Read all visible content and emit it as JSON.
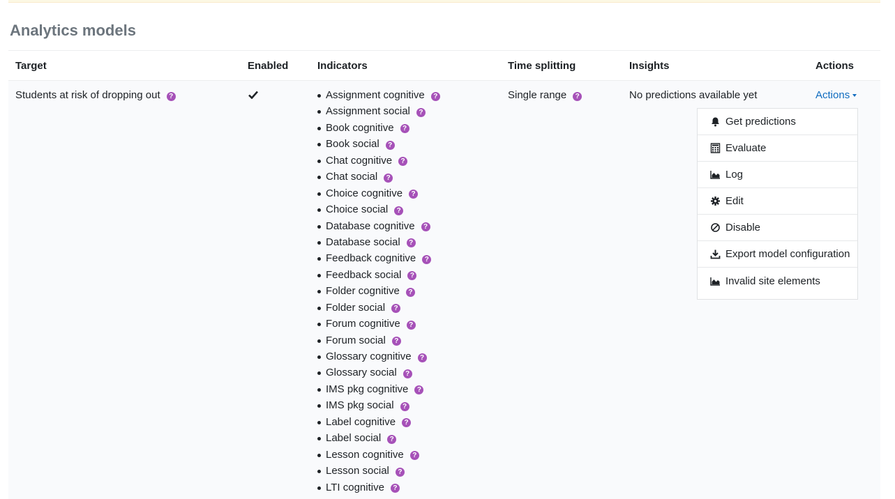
{
  "page": {
    "title": "Analytics models"
  },
  "table": {
    "headers": [
      "Target",
      "Enabled",
      "Indicators",
      "Time splitting",
      "Insights",
      "Actions"
    ],
    "row": {
      "target": "Students at risk of dropping out",
      "enabled": true,
      "time_splitting": "Single range",
      "insights": "No predictions available yet",
      "actions_label": "Actions",
      "indicators": [
        "Assignment cognitive",
        "Assignment social",
        "Book cognitive",
        "Book social",
        "Chat cognitive",
        "Chat social",
        "Choice cognitive",
        "Choice social",
        "Database cognitive",
        "Database social",
        "Feedback cognitive",
        "Feedback social",
        "Folder cognitive",
        "Folder social",
        "Forum cognitive",
        "Forum social",
        "Glossary cognitive",
        "Glossary social",
        "IMS pkg cognitive",
        "IMS pkg social",
        "Label cognitive",
        "Label social",
        "Lesson cognitive",
        "Lesson social",
        "LTI cognitive"
      ]
    }
  },
  "actions_menu": [
    {
      "label": "Get predictions",
      "icon": "bell-icon"
    },
    {
      "label": "Evaluate",
      "icon": "calculator-icon"
    },
    {
      "label": "Log",
      "icon": "area-chart-icon"
    },
    {
      "label": "Edit",
      "icon": "gear-icon"
    },
    {
      "label": "Disable",
      "icon": "ban-icon"
    },
    {
      "label": "Export model configuration",
      "icon": "download-icon"
    },
    {
      "label": "Invalid site elements",
      "icon": "area-chart-icon"
    }
  ],
  "colors": {
    "help": "#a651b8",
    "link": "#0f6cbf"
  }
}
